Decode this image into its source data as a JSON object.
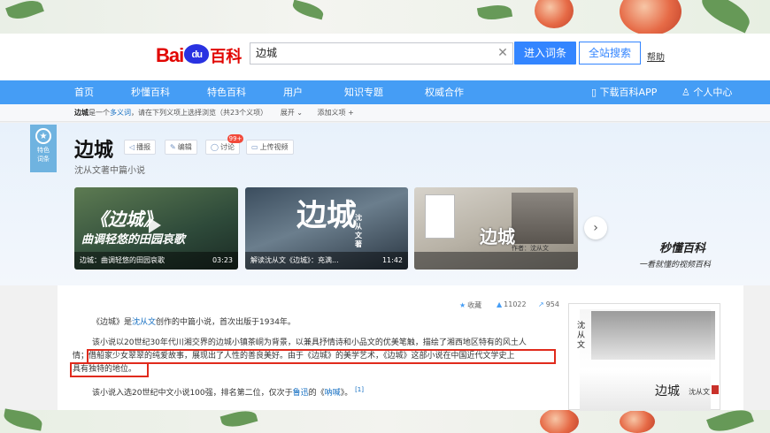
{
  "header": {
    "logo_text": "Bai",
    "logo_paw": "du",
    "logo_baike": "百科",
    "search_value": "边城",
    "enter_label": "进入词条",
    "all_label": "全站搜索",
    "help_label": "帮助"
  },
  "nav": {
    "items": [
      "首页",
      "秒懂百科",
      "特色百科",
      "用户",
      "知识专题",
      "权威合作"
    ],
    "download_app": "下载百科APP",
    "user_center": "个人中心"
  },
  "polysemy": {
    "keyword": "边城",
    "text1": "是一个",
    "link1": "多义词",
    "text2": "，请在下列义项上选择浏览（共23个义项）",
    "expand": "展开",
    "add": "添加义项"
  },
  "lemma": {
    "badge_line1": "特色",
    "badge_line2": "词条",
    "title": "边城",
    "subtitle": "沈从文著中篇小说",
    "tools": {
      "collect": "播报",
      "edit": "编辑",
      "discuss": "讨论",
      "discuss_count": "99+",
      "upload": "上传视频"
    }
  },
  "videos": [
    {
      "caption": "边城：曲调轻悠的田园哀歌",
      "duration": "03:23",
      "overlay": "《边城》",
      "overlay2": "曲调轻悠的田园哀歌"
    },
    {
      "caption": "解读沈从文《边城》：充满...",
      "duration": "11:42",
      "overlay": "边城",
      "overlay2": "沈从文著"
    },
    {
      "caption": "",
      "duration": "",
      "overlay": "边城",
      "overlay2": "作者：沈从文"
    }
  ],
  "miaodong": {
    "title": "秒懂百科",
    "sub": "一看就懂的视频百科"
  },
  "stats": {
    "collect_label": "收藏",
    "likes": "11022",
    "shares": "954"
  },
  "content": {
    "p1_a": "《边城》是",
    "p1_link": "沈从文",
    "p1_b": "创作的中篇小说，首次出版于1934年。",
    "p2_line1": "该小说以20世纪30年代川湘交界的边城小镇茶峒为背景，以兼具抒情诗和小品文的优美笔触，描绘了湘西地区特有的风土人",
    "p2_line2": "情；借船家少女翠翠的纯爱故事，展现出了人性的善良美好。由于《边城》的美学艺术，《边城》这部小说在中国近代文学史上",
    "p2_line3": "具有独特的地位。",
    "p3_a": "该小说入选20世纪中文小说100强，排名第二位，仅次于",
    "p3_link1": "鲁迅",
    "p3_b": "的《",
    "p3_link2": "呐喊",
    "p3_c": "》。",
    "p3_ref": "[1]"
  },
  "book": {
    "vertical": "沈从文",
    "title": "边城",
    "author": "沈从文"
  }
}
